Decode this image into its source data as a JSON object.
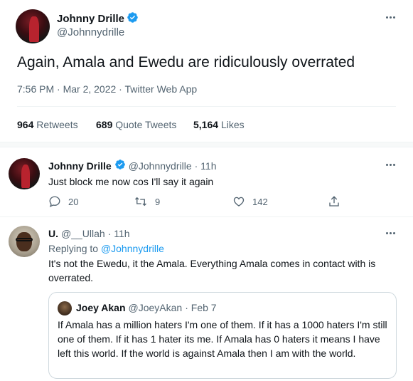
{
  "main_tweet": {
    "name": "Johnny Drille",
    "handle": "@Johnnydrille",
    "text": "Again, Amala and Ewedu are ridiculously overrated",
    "meta": "7:56 PM · Mar 2, 2022 · Twitter Web App",
    "stats": [
      {
        "count": "964",
        "label": "Retweets"
      },
      {
        "count": "689",
        "label": "Quote Tweets"
      },
      {
        "count": "5,164",
        "label": "Likes"
      }
    ]
  },
  "reply1": {
    "name": "Johnny Drille",
    "handle": "@Johnnydrille",
    "time": "· 11h",
    "text": "Just block me now cos I'll say it again",
    "actions": {
      "replies": "20",
      "retweets": "9",
      "likes": "142"
    }
  },
  "reply2": {
    "name": "U.",
    "handle": "@__Ullah",
    "time": "· 11h",
    "replying_prefix": "Replying to",
    "replying_to": "@Johnnydrille",
    "text": "It's not the Ewedu, it the Amala. Everything  Amala comes in contact with is overrated.",
    "quote": {
      "name": "Joey Akan",
      "handle": "@JoeyAkan",
      "time": "· Feb 7",
      "text": "If Amala has a million haters I'm one of them. If it has a 1000 haters I'm still one of them. If it has 1 hater its me. If Amala has 0 haters it means I have left this world. If the world is against Amala then I am with the world."
    }
  },
  "colors": {
    "accent": "#1d9bf0",
    "muted": "#536471",
    "text": "#0f1419",
    "border": "#eff3f4"
  }
}
